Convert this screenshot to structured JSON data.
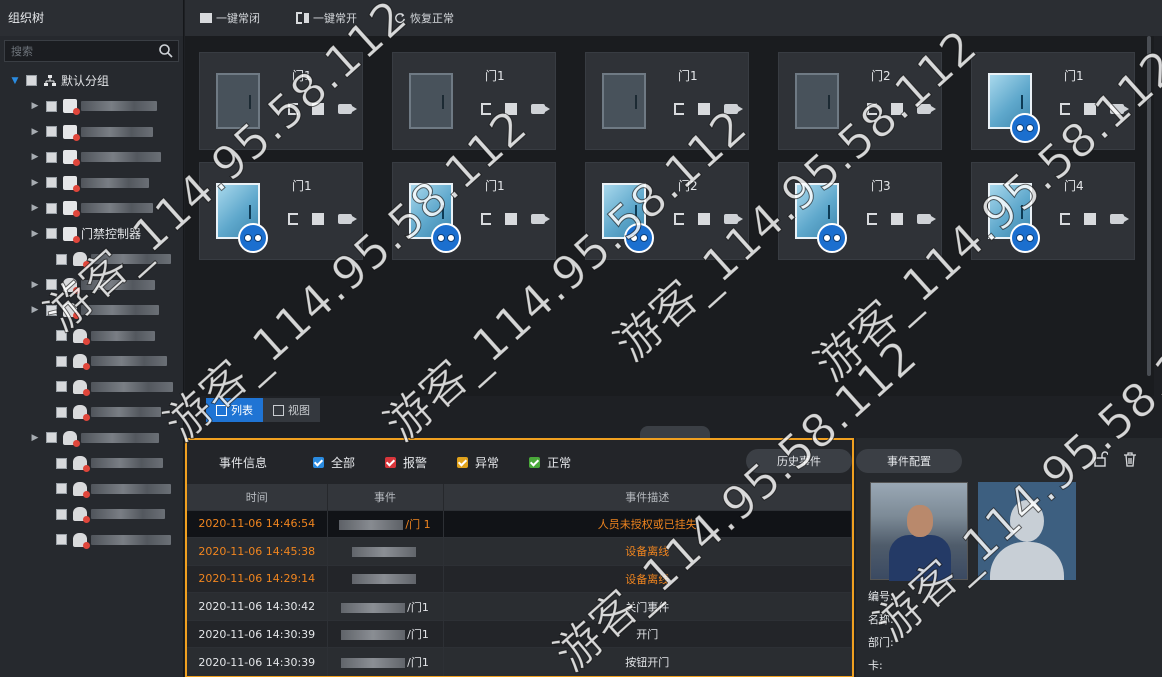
{
  "left_panel": {
    "title": "组织树",
    "search_placeholder": "搜索",
    "root_label": "默认分组",
    "controller_label": "门禁控制器"
  },
  "toolbar": {
    "always_close": "一键常闭",
    "always_open": "一键常开",
    "restore": "恢复正常"
  },
  "doors": [
    {
      "name": "门1",
      "online": false
    },
    {
      "name": "门1",
      "online": false
    },
    {
      "name": "门1",
      "online": false
    },
    {
      "name": "门2",
      "online": false
    },
    {
      "name": "门1",
      "online": true
    },
    {
      "name": "门1",
      "online": true
    },
    {
      "name": "门1",
      "online": true
    },
    {
      "name": "门2",
      "online": true
    },
    {
      "name": "门3",
      "online": true
    },
    {
      "name": "门4",
      "online": true
    }
  ],
  "view_tabs": {
    "list": "列表",
    "view": "视图"
  },
  "events": {
    "title": "事件信息",
    "filters": [
      {
        "label": "全部",
        "color": "#2a8be0"
      },
      {
        "label": "报警",
        "color": "#d8363b"
      },
      {
        "label": "异常",
        "color": "#e0a21c"
      },
      {
        "label": "正常",
        "color": "#4aa83a"
      }
    ],
    "columns": [
      "时间",
      "事件",
      "事件描述"
    ],
    "rows": [
      {
        "time": "2020-11-06 14:46:54",
        "event": "/门 1",
        "desc": "人员未授权或已挂失"
      },
      {
        "time": "2020-11-06 14:45:38",
        "event": "",
        "desc": "设备离线"
      },
      {
        "time": "2020-11-06 14:29:14",
        "event": "",
        "desc": "设备离线"
      },
      {
        "time": "2020-11-06 14:30:42",
        "event": "/门1",
        "desc": "关门事件"
      },
      {
        "time": "2020-11-06 14:30:39",
        "event": "/门1",
        "desc": "开门"
      },
      {
        "time": "2020-11-06 14:30:39",
        "event": "/门1",
        "desc": "按钮开门"
      }
    ],
    "history_button": "历史事件",
    "config_button": "事件配置"
  },
  "detail": {
    "id_label": "编号:",
    "name_label": "名称:",
    "dept_label": "部门:",
    "card_label": "卡:"
  },
  "watermark": "游客_114.95.58.112",
  "colors": {
    "accent": "#1f74d4",
    "alarm": "#f0851f",
    "highlight_border": "#f0a020"
  }
}
